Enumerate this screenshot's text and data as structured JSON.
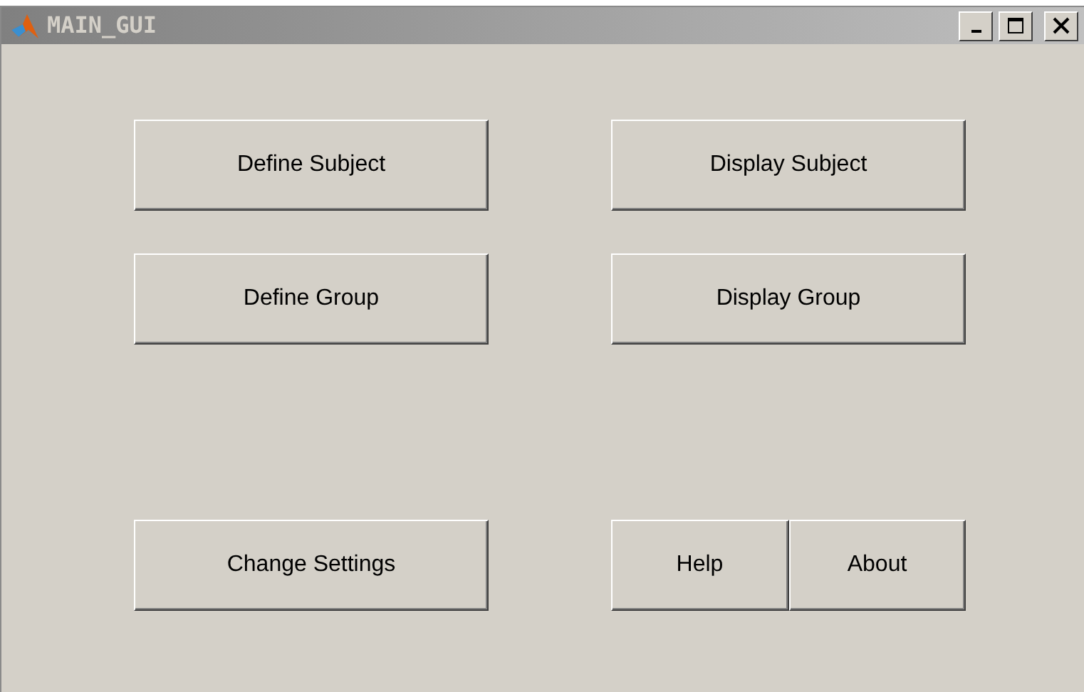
{
  "window": {
    "title": "MAIN_GUI"
  },
  "rows": [
    {
      "left": [
        "Define Subject"
      ],
      "right": [
        "Display Subject"
      ]
    },
    {
      "left": [
        "Define Group"
      ],
      "right": [
        "Display Group"
      ]
    },
    {
      "left": [
        "Change Settings"
      ],
      "right": [
        "Help",
        "About"
      ]
    }
  ]
}
